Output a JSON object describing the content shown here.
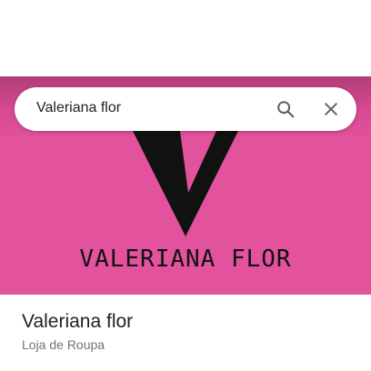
{
  "search": {
    "query": "Valeriana flor"
  },
  "hero": {
    "brand_text": "VALERIANA FLOR"
  },
  "place": {
    "name": "Valeriana flor",
    "category": "Loja de Roupa"
  },
  "colors": {
    "accent_pink": "#e2529d",
    "dark_pink": "#b23d78",
    "logo": "#111111"
  },
  "icons": [
    "search-icon",
    "close-icon"
  ]
}
